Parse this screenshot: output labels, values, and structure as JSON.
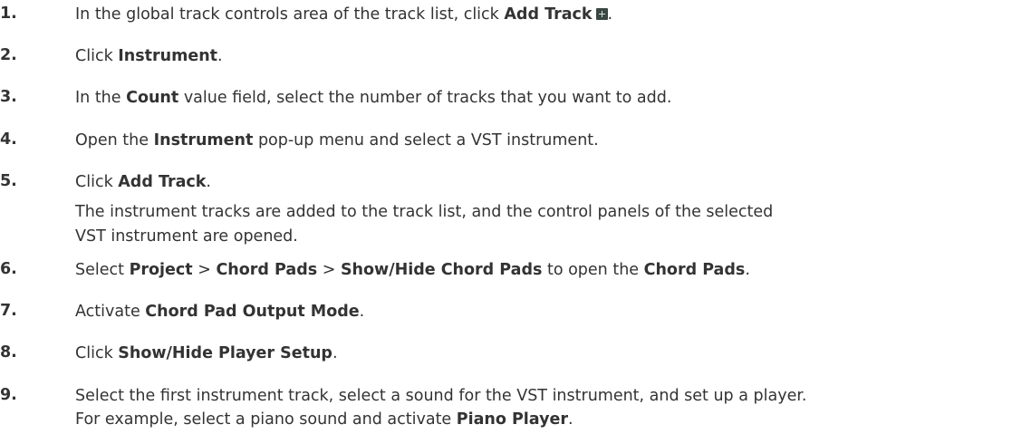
{
  "steps": [
    {
      "num": "1.",
      "parts": [
        "In the global track controls area of the track list, click ",
        "Add Track",
        "."
      ],
      "icon": "add-track-icon"
    },
    {
      "num": "2.",
      "parts": [
        "Click ",
        "Instrument",
        "."
      ]
    },
    {
      "num": "3.",
      "parts": [
        "In the ",
        "Count",
        " value field, select the number of tracks that you want to add."
      ]
    },
    {
      "num": "4.",
      "parts": [
        "Open the ",
        "Instrument",
        " pop-up menu and select a VST instrument."
      ]
    },
    {
      "num": "5.",
      "parts": [
        "Click ",
        "Add Track",
        "."
      ],
      "result_lines": [
        "The instrument tracks are added to the track list, and the control panels of the selected",
        "VST instrument are opened."
      ]
    },
    {
      "num": "6.",
      "parts": [
        "Select ",
        "Project",
        " > ",
        "Chord Pads",
        " > ",
        "Show/Hide Chord Pads",
        " to open the ",
        "Chord Pads",
        "."
      ]
    },
    {
      "num": "7.",
      "parts": [
        "Activate ",
        "Chord Pad Output Mode",
        "."
      ]
    },
    {
      "num": "8.",
      "parts": [
        "Click ",
        "Show/Hide Player Setup",
        "."
      ]
    },
    {
      "num": "9.",
      "parts": [
        "Select the first instrument track, select a sound for the VST instrument, and set up a player."
      ],
      "result_parts": [
        "For example, select a piano sound and activate ",
        "Piano Player",
        "."
      ]
    }
  ]
}
